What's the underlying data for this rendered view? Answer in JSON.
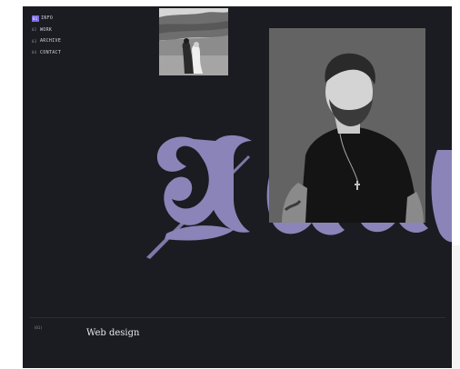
{
  "nav": {
    "items": [
      {
        "num": "01",
        "label": "INFO",
        "active": true
      },
      {
        "num": "02",
        "label": "WORK",
        "active": false
      },
      {
        "num": "03",
        "label": "ARCHIVE",
        "active": false
      },
      {
        "num": "04",
        "label": "CONTACT",
        "active": false
      }
    ]
  },
  "bottom": {
    "num": "(01)",
    "title": "Web design"
  },
  "colors": {
    "background": "#1b1b22",
    "accent": "#7a6be0",
    "script": "#8b84b8"
  }
}
